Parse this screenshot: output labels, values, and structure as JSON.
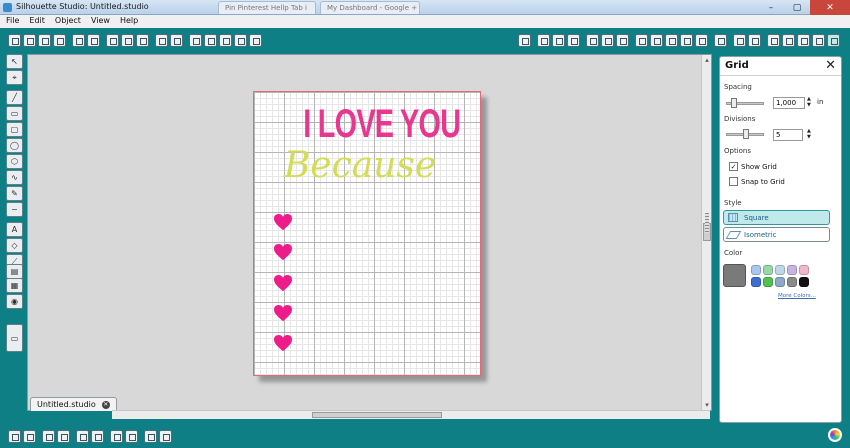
{
  "window": {
    "title": "Silhouette Studio: Untitled.studio",
    "browser_tabs": [
      "Pin Pinterest Hellp Tab i",
      "My Dashboard - Google +"
    ]
  },
  "menu": [
    "File",
    "Edit",
    "Object",
    "View",
    "Help"
  ],
  "document": {
    "tab_label": "Untitled.studio",
    "design_title": "I LOVE YOU",
    "design_subtitle": "Because",
    "heart_count": 5
  },
  "grid_panel": {
    "title": "Grid",
    "spacing_label": "Spacing",
    "spacing_value": "1,000",
    "spacing_unit": "in",
    "divisions_label": "Divisions",
    "divisions_value": "5",
    "options_label": "Options",
    "show_grid_label": "Show Grid",
    "show_grid_checked": true,
    "snap_to_grid_label": "Snap to Grid",
    "snap_to_grid_checked": false,
    "style_label": "Style",
    "style_options": [
      "Square",
      "Isometric"
    ],
    "selected_style": "Square",
    "color_label": "Color",
    "selected_color": "#7a7a7a",
    "swatches": [
      "#a9c7ef",
      "#9ad7a6",
      "#bfd6e8",
      "#c6b4e6",
      "#f2b7c9",
      "#3d6fd3",
      "#4fc34f",
      "#8ea9c8",
      "#8a8a8a",
      "#111111"
    ],
    "more_colors_label": "More Colors..."
  },
  "colors": {
    "accent_teal": "#0f7f86",
    "title_pink": "#e8378f",
    "subtitle_yellow": "#d2dc55",
    "heart_pink": "#ee1c8a"
  }
}
